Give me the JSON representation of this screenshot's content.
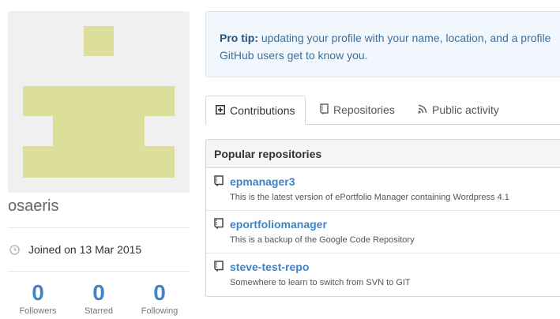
{
  "profile": {
    "username": "osaeris",
    "joined": "Joined on 13 Mar 2015",
    "stats": [
      {
        "value": "0",
        "label": "Followers"
      },
      {
        "value": "0",
        "label": "Starred"
      },
      {
        "value": "0",
        "label": "Following"
      }
    ]
  },
  "protip": {
    "label": "Pro tip:",
    "line1": " updating your profile with your name, location, and a profile",
    "line2": "GitHub users get to know you."
  },
  "tabs": [
    {
      "label": "Contributions",
      "icon": "contributions-icon",
      "selected": true
    },
    {
      "label": "Repositories",
      "icon": "repo-icon",
      "selected": false
    },
    {
      "label": "Public activity",
      "icon": "rss-icon",
      "selected": false
    }
  ],
  "popular": {
    "title": "Popular repositories",
    "repos": [
      {
        "name": "epmanager3",
        "description": "This is the latest version of ePortfolio Manager containing Wordpress 4.1"
      },
      {
        "name": "eportfoliomanager",
        "description": "This is a backup of the Google Code Repository"
      },
      {
        "name": "steve-test-repo",
        "description": "Somewhere to learn to switch from SVN to GIT"
      }
    ]
  },
  "colors": {
    "accent": "#4183c4",
    "identicon": "#dcdf9a"
  }
}
